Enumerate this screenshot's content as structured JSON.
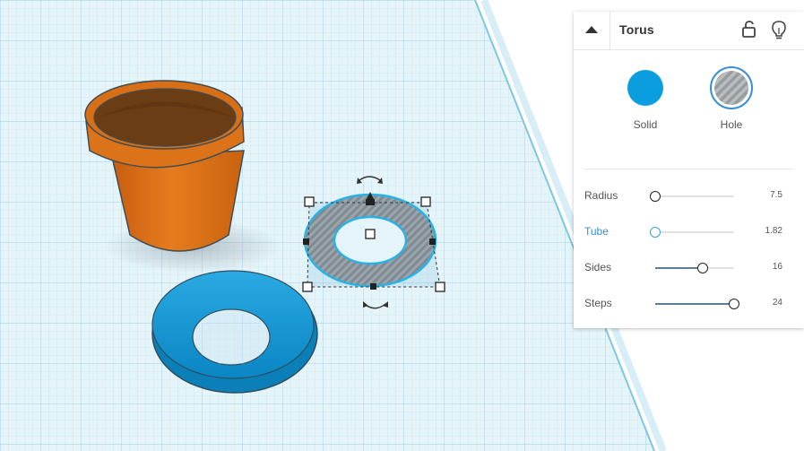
{
  "panel": {
    "title": "Torus",
    "colors": {
      "solid": "#0a9ede",
      "accent": "#3b8fd3"
    },
    "modes": {
      "solid_label": "Solid",
      "hole_label": "Hole"
    },
    "params": [
      {
        "name": "Radius",
        "value": "7.5",
        "fraction": 0.0,
        "active": false
      },
      {
        "name": "Tube",
        "value": "1.82",
        "fraction": 0.0,
        "active": true
      },
      {
        "name": "Sides",
        "value": "16",
        "fraction": 0.6,
        "active": false
      },
      {
        "name": "Steps",
        "value": "24",
        "fraction": 1.0,
        "active": false
      }
    ]
  },
  "icons": [
    "collapse-arrow-icon",
    "lock-icon",
    "lightbulb-icon"
  ],
  "scene": {
    "objects": [
      "flower-pot",
      "torus-solid",
      "torus-hole-selected"
    ]
  }
}
